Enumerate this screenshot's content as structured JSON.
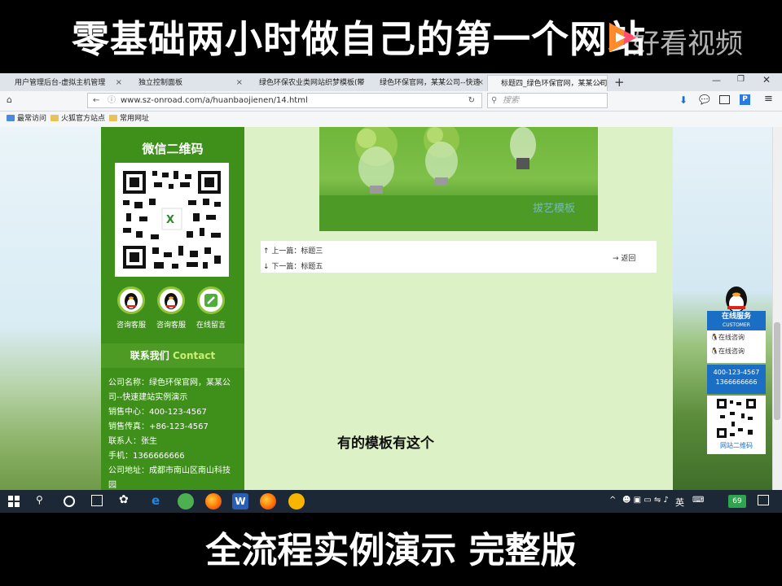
{
  "video": {
    "top_title": "零基础两小时做自己的第一个网站",
    "watermark": "好看视频",
    "bottom_title": "全流程实例演示 完整版"
  },
  "browser": {
    "tabs": [
      {
        "label": "用户管理后台-虚拟主机管理",
        "active": false
      },
      {
        "label": "独立控制面板",
        "active": false
      },
      {
        "label": "绿色环保农业类网站织梦模板(带",
        "active": false
      },
      {
        "label": "绿色环保官网，某某公司--快速",
        "active": false
      },
      {
        "label": "标题四_绿色环保官网，某某公司",
        "active": true
      }
    ],
    "new_tab": "+",
    "url": "www.sz-onroad.com/a/huanbaojienen/14.html",
    "search_placeholder": "搜索",
    "bookmarks": [
      "最常访问",
      "火狐官方站点",
      "常用网址"
    ]
  },
  "page": {
    "sidebar": {
      "qr_title": "微信二维码",
      "services": [
        {
          "label": "咨询客服",
          "icon": "qq-penguin-icon"
        },
        {
          "label": "咨询客服",
          "icon": "qq-penguin-icon"
        },
        {
          "label": "在线留言",
          "icon": "pencil-note-icon"
        }
      ],
      "contact_title_cn": "联系我们",
      "contact_title_en": "Contact",
      "contact_lines": [
        "公司名称：绿色环保官网，某某公",
        "司--快速建站实例演示",
        "销售中心：400-123-4567",
        "销售传真：+86-123-4567",
        "联系人：张生",
        "手机：1366666666",
        "公司地址：成都市南山区南山科技",
        "园"
      ]
    },
    "article": {
      "prev_label": "上一篇：标题三",
      "next_label": "下一篇：标题五",
      "back_label": "返回",
      "image_watermark": "拔艺模板"
    },
    "caption": "有的模板有这个",
    "online_service": {
      "title": "在线服务",
      "subtitle": "CUSTOMER",
      "items": [
        "在线咨询",
        "在线咨询"
      ],
      "phone": "400-123-4567",
      "mobile": "1366666666",
      "qr_label": "网站二维码"
    }
  },
  "taskbar": {
    "ime": "英",
    "badge": "69"
  },
  "colors": {
    "sidebar_green": "#3f8f1b",
    "main_bg": "#ddf1c6",
    "widget_blue": "#1a6fc4",
    "accent_green": "#c7ef73"
  }
}
